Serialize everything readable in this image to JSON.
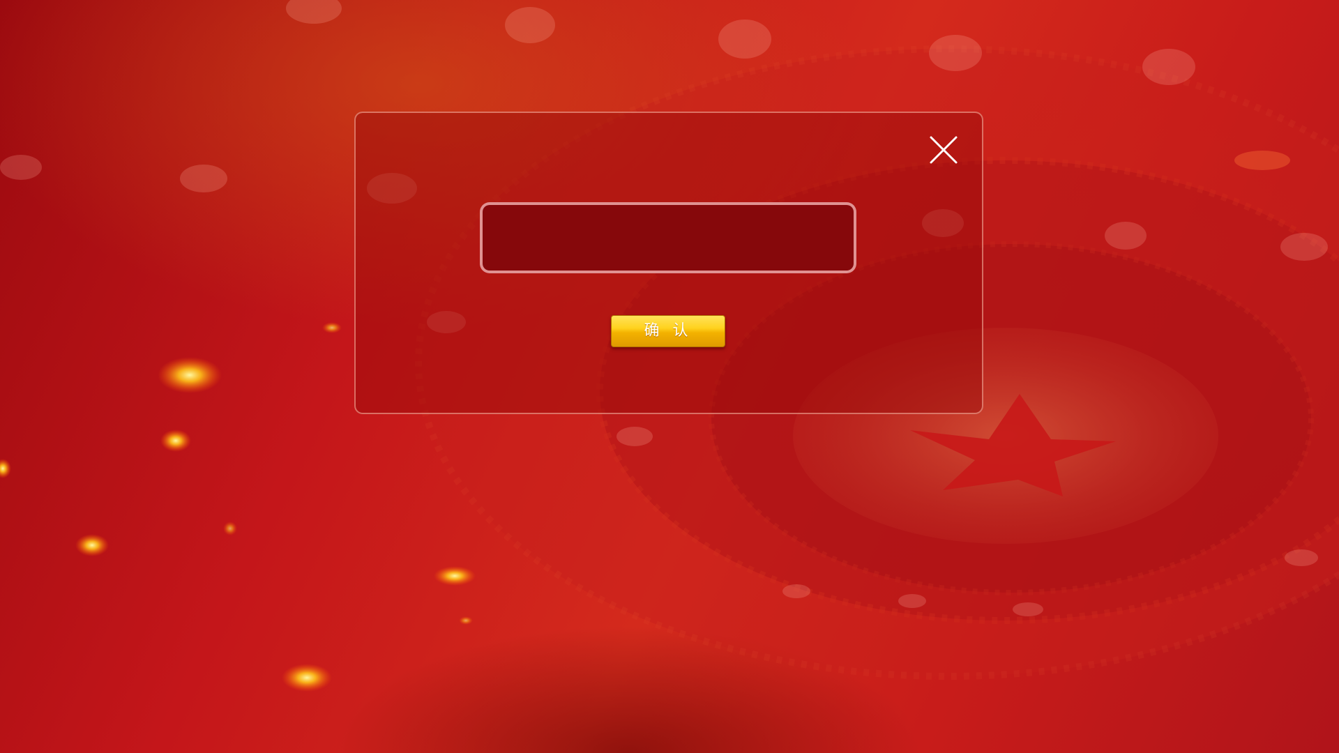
{
  "dialog": {
    "input": {
      "value": "",
      "placeholder": ""
    },
    "confirm_label": "确 认",
    "close_icon": "close-icon"
  },
  "background": {
    "emblem_icon": "star-emblem",
    "colors": {
      "base_red": "#c4161a",
      "dark_red": "#86080b",
      "button_gold": "#ffd21e"
    }
  }
}
